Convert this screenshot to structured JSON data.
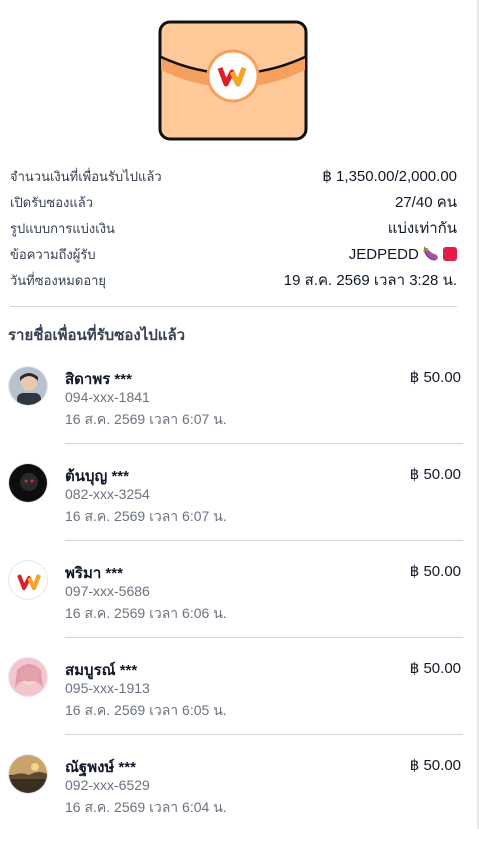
{
  "summary": {
    "amount_label": "จำนวนเงินที่เพื่อนรับไปแล้ว",
    "amount_value": "฿ 1,350.00/2,000.00",
    "opened_label": "เปิดรับซองแล้ว",
    "opened_value": "27/40 คน",
    "split_label": "รูปแบบการแบ่งเงิน",
    "split_value": "แบ่งเท่ากัน",
    "message_label": "ข้อความถึงผู้รับ",
    "message_value": "JEDPEDD",
    "expiry_label": "วันที่ซองหมดอายุ",
    "expiry_value": "19 ส.ค. 2569 เวลา 3:28 น."
  },
  "list_title": "รายชื่อเพื่อนที่รับซองไปแล้ว",
  "recipients": [
    {
      "name": "สิดาพร ***",
      "amount": "฿ 50.00",
      "phone": "094-xxx-1841",
      "date": "16 ส.ค. 2569 เวลา 6:07 น."
    },
    {
      "name": "ต้นบุญ ***",
      "amount": "฿ 50.00",
      "phone": "082-xxx-3254",
      "date": "16 ส.ค. 2569 เวลา 6:07 น."
    },
    {
      "name": "พริมา ***",
      "amount": "฿ 50.00",
      "phone": "097-xxx-5686",
      "date": "16 ส.ค. 2569 เวลา 6:06 น."
    },
    {
      "name": "สมบูรณ์ ***",
      "amount": "฿ 50.00",
      "phone": "095-xxx-1913",
      "date": "16 ส.ค. 2569 เวลา 6:05 น."
    },
    {
      "name": "ณัฐพงษ์ ***",
      "amount": "฿ 50.00",
      "phone": "092-xxx-6529",
      "date": "16 ส.ค. 2569 เวลา 6:04 น."
    }
  ],
  "colors": {
    "envelope_fill": "#ffc99a",
    "envelope_flap": "#f5a05c",
    "logo_red": "#e11d2a",
    "logo_yellow": "#f5a623"
  }
}
